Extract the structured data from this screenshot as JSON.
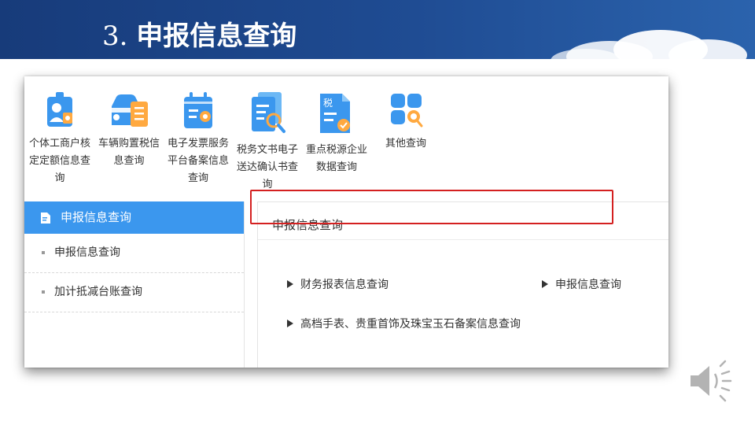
{
  "slide": {
    "number": "3.",
    "title": "申报信息查询"
  },
  "icons": [
    {
      "name": "id-badge-icon",
      "label": "个体工商户核定定额信息查询"
    },
    {
      "name": "car-document-icon",
      "label": "车辆购置税信息查询"
    },
    {
      "name": "calendar-invoice-icon",
      "label": "电子发票服务平台备案信息查询"
    },
    {
      "name": "document-search-icon",
      "label": "税务文书电子送达确认书查询"
    },
    {
      "name": "tax-document-icon",
      "label": "重点税源企业数据查询",
      "badge": "税"
    },
    {
      "name": "grid-search-icon",
      "label": "其他查询"
    }
  ],
  "sidebar": {
    "header": "申报信息查询",
    "items": [
      {
        "label": "申报信息查询"
      },
      {
        "label": "加计抵减台账查询"
      }
    ]
  },
  "panel": {
    "title": "申报信息查询",
    "links": [
      {
        "label": "财务报表信息查询"
      },
      {
        "label": "申报信息查询"
      },
      {
        "label": "高档手表、贵重首饰及珠宝玉石备案信息查询"
      }
    ]
  },
  "colors": {
    "banner": "#1f4c93",
    "icon_blue": "#3b97ee",
    "icon_orange": "#ffa940",
    "sidebar_active": "#3b97ee",
    "highlight_border": "#d42020"
  }
}
